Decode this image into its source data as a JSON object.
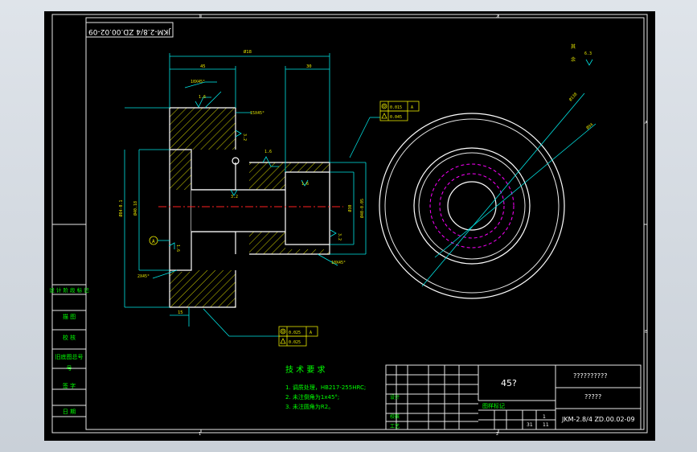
{
  "drawing_number_stamp": "JKM-2.8/4 ZD.00.02-09",
  "dimensions": {
    "overall_length": "Ø18",
    "left_flange": "45",
    "right_step": "30",
    "bottom": "15",
    "chamfer_top": "10X45°",
    "chamfer_mid": "15X45°",
    "chamfer_low": "2X45°",
    "chamfer_bottom": "10X45°",
    "dia_left_outer": "Ø84-0.1",
    "dia_left_inner": "Ø40.18",
    "dia_right_outer": "Ø40-0.05",
    "dia_bore": "Ø30",
    "datum": "A",
    "circle_r1": "Ø138",
    "circle_r2": "Ø94"
  },
  "surface_finish": {
    "v1": "1.6",
    "v2": "3.2",
    "v3": "1.6",
    "v4": "3.2",
    "v5": "1.6",
    "v6": "1.6",
    "v7": "3.2",
    "v8": "3.2",
    "other_label_1": "其",
    "other_label_2": "余",
    "other_value": "6.3"
  },
  "tolerance_frames": {
    "top_row1_value": "0.015",
    "top_row1_datum": "A",
    "top_row2_value": "0.045",
    "bot_row1_value": "0.025",
    "bot_row1_datum": "A",
    "bot_row2_value": "0.025"
  },
  "tech_requirements": {
    "title": "技 术 要 求",
    "line1": "1. 调质处理，HB217-255HRC;",
    "line2": "2. 未注倒角为1x45°;",
    "line3": "3. 未注圆角为R2。"
  },
  "left_table": {
    "r1": "设 计 阶 段 标 记",
    "r2": "描 图",
    "r3": "校 核",
    "r4": "旧底图总号",
    "r5": "号",
    "r6": "签 字",
    "r7": "日 期"
  },
  "title_block": {
    "material": "45?",
    "company": "??????????",
    "part_name": "?????",
    "drawing_no": "JKM-2.8/4 ZD.00.02-09",
    "stage_label": "图样标记",
    "scale_1": "1",
    "scale_11": "11",
    "sheets": "31",
    "row_a": "设计",
    "row_b": "校核",
    "row_c": "工艺"
  },
  "zone_marks": {
    "top1": "1",
    "top2": "2",
    "right_a": "A",
    "right_b": "B",
    "bottom1": "1",
    "bottom2": "2"
  }
}
